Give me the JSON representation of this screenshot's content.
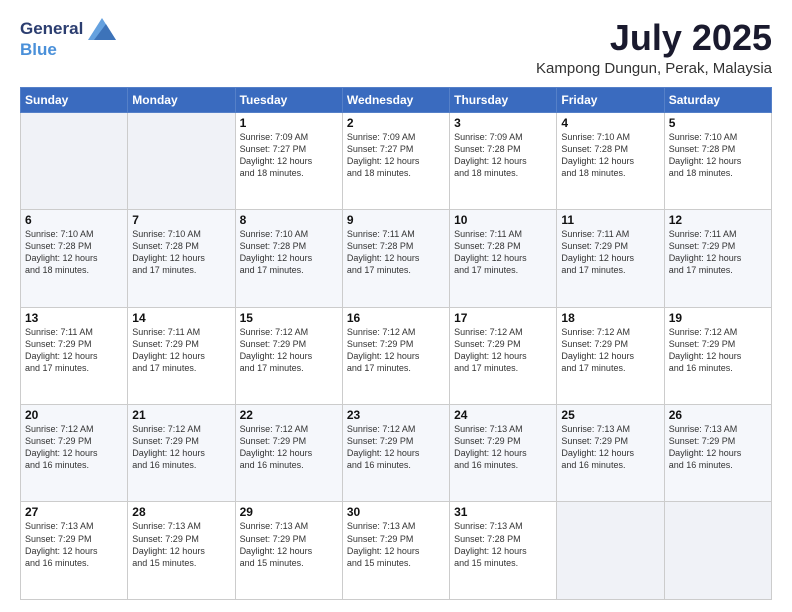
{
  "header": {
    "logo_general": "General",
    "logo_blue": "Blue",
    "month_title": "July 2025",
    "location": "Kampong Dungun, Perak, Malaysia"
  },
  "weekdays": [
    "Sunday",
    "Monday",
    "Tuesday",
    "Wednesday",
    "Thursday",
    "Friday",
    "Saturday"
  ],
  "weeks": [
    [
      {
        "day": "",
        "info": ""
      },
      {
        "day": "",
        "info": ""
      },
      {
        "day": "1",
        "info": "Sunrise: 7:09 AM\nSunset: 7:27 PM\nDaylight: 12 hours\nand 18 minutes."
      },
      {
        "day": "2",
        "info": "Sunrise: 7:09 AM\nSunset: 7:27 PM\nDaylight: 12 hours\nand 18 minutes."
      },
      {
        "day": "3",
        "info": "Sunrise: 7:09 AM\nSunset: 7:28 PM\nDaylight: 12 hours\nand 18 minutes."
      },
      {
        "day": "4",
        "info": "Sunrise: 7:10 AM\nSunset: 7:28 PM\nDaylight: 12 hours\nand 18 minutes."
      },
      {
        "day": "5",
        "info": "Sunrise: 7:10 AM\nSunset: 7:28 PM\nDaylight: 12 hours\nand 18 minutes."
      }
    ],
    [
      {
        "day": "6",
        "info": "Sunrise: 7:10 AM\nSunset: 7:28 PM\nDaylight: 12 hours\nand 18 minutes."
      },
      {
        "day": "7",
        "info": "Sunrise: 7:10 AM\nSunset: 7:28 PM\nDaylight: 12 hours\nand 17 minutes."
      },
      {
        "day": "8",
        "info": "Sunrise: 7:10 AM\nSunset: 7:28 PM\nDaylight: 12 hours\nand 17 minutes."
      },
      {
        "day": "9",
        "info": "Sunrise: 7:11 AM\nSunset: 7:28 PM\nDaylight: 12 hours\nand 17 minutes."
      },
      {
        "day": "10",
        "info": "Sunrise: 7:11 AM\nSunset: 7:28 PM\nDaylight: 12 hours\nand 17 minutes."
      },
      {
        "day": "11",
        "info": "Sunrise: 7:11 AM\nSunset: 7:29 PM\nDaylight: 12 hours\nand 17 minutes."
      },
      {
        "day": "12",
        "info": "Sunrise: 7:11 AM\nSunset: 7:29 PM\nDaylight: 12 hours\nand 17 minutes."
      }
    ],
    [
      {
        "day": "13",
        "info": "Sunrise: 7:11 AM\nSunset: 7:29 PM\nDaylight: 12 hours\nand 17 minutes."
      },
      {
        "day": "14",
        "info": "Sunrise: 7:11 AM\nSunset: 7:29 PM\nDaylight: 12 hours\nand 17 minutes."
      },
      {
        "day": "15",
        "info": "Sunrise: 7:12 AM\nSunset: 7:29 PM\nDaylight: 12 hours\nand 17 minutes."
      },
      {
        "day": "16",
        "info": "Sunrise: 7:12 AM\nSunset: 7:29 PM\nDaylight: 12 hours\nand 17 minutes."
      },
      {
        "day": "17",
        "info": "Sunrise: 7:12 AM\nSunset: 7:29 PM\nDaylight: 12 hours\nand 17 minutes."
      },
      {
        "day": "18",
        "info": "Sunrise: 7:12 AM\nSunset: 7:29 PM\nDaylight: 12 hours\nand 17 minutes."
      },
      {
        "day": "19",
        "info": "Sunrise: 7:12 AM\nSunset: 7:29 PM\nDaylight: 12 hours\nand 16 minutes."
      }
    ],
    [
      {
        "day": "20",
        "info": "Sunrise: 7:12 AM\nSunset: 7:29 PM\nDaylight: 12 hours\nand 16 minutes."
      },
      {
        "day": "21",
        "info": "Sunrise: 7:12 AM\nSunset: 7:29 PM\nDaylight: 12 hours\nand 16 minutes."
      },
      {
        "day": "22",
        "info": "Sunrise: 7:12 AM\nSunset: 7:29 PM\nDaylight: 12 hours\nand 16 minutes."
      },
      {
        "day": "23",
        "info": "Sunrise: 7:12 AM\nSunset: 7:29 PM\nDaylight: 12 hours\nand 16 minutes."
      },
      {
        "day": "24",
        "info": "Sunrise: 7:13 AM\nSunset: 7:29 PM\nDaylight: 12 hours\nand 16 minutes."
      },
      {
        "day": "25",
        "info": "Sunrise: 7:13 AM\nSunset: 7:29 PM\nDaylight: 12 hours\nand 16 minutes."
      },
      {
        "day": "26",
        "info": "Sunrise: 7:13 AM\nSunset: 7:29 PM\nDaylight: 12 hours\nand 16 minutes."
      }
    ],
    [
      {
        "day": "27",
        "info": "Sunrise: 7:13 AM\nSunset: 7:29 PM\nDaylight: 12 hours\nand 16 minutes."
      },
      {
        "day": "28",
        "info": "Sunrise: 7:13 AM\nSunset: 7:29 PM\nDaylight: 12 hours\nand 15 minutes."
      },
      {
        "day": "29",
        "info": "Sunrise: 7:13 AM\nSunset: 7:29 PM\nDaylight: 12 hours\nand 15 minutes."
      },
      {
        "day": "30",
        "info": "Sunrise: 7:13 AM\nSunset: 7:29 PM\nDaylight: 12 hours\nand 15 minutes."
      },
      {
        "day": "31",
        "info": "Sunrise: 7:13 AM\nSunset: 7:28 PM\nDaylight: 12 hours\nand 15 minutes."
      },
      {
        "day": "",
        "info": ""
      },
      {
        "day": "",
        "info": ""
      }
    ]
  ]
}
